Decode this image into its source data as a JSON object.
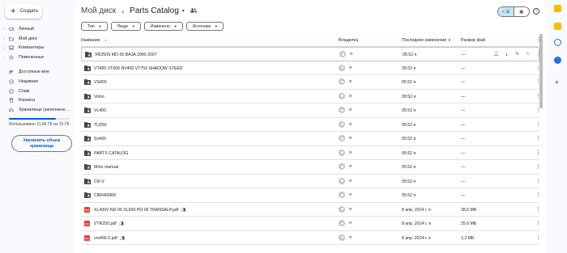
{
  "new_label": "Создать",
  "sidebar": {
    "items": [
      {
        "label": "Личный",
        "icon": "drive-icon"
      },
      {
        "label": "Мой диск",
        "icon": "folder-icon"
      },
      {
        "label": "Компьютеры",
        "icon": "computer-icon"
      },
      {
        "label": "Помеченные",
        "icon": "star-icon"
      },
      {
        "label": "Доступные мне",
        "icon": "people-icon"
      },
      {
        "label": "Недавние",
        "icon": "clock-icon"
      },
      {
        "label": "Спам",
        "icon": "spam-icon"
      },
      {
        "label": "Корзина",
        "icon": "trash-icon"
      },
      {
        "label": "Хранилище (заполнено ...",
        "icon": "cloud-icon"
      }
    ],
    "storage_text": "Использовано 11,46 ГБ из 15 ГБ",
    "storage_fraction": 0.764,
    "upgrade_label": "Увеличить объем хранилища"
  },
  "breadcrumb": {
    "root": "Мой диск",
    "current": "Parts Catalog"
  },
  "filters": [
    "Тип",
    "Люди",
    "Изменено",
    "Источник"
  ],
  "columns": {
    "name": "Название",
    "owner": "Владелец",
    "modified": "Последнее изменение",
    "size": "Размер фай"
  },
  "files": [
    {
      "name": "XR250S MD-30 BAJA 2000-2007",
      "type": "folder",
      "owner": "я",
      "modified": "05:52 я",
      "size": "—",
      "selected": true
    },
    {
      "name": "VT400 VT600 NV400 VT750 SHADOW STEED",
      "type": "folder",
      "owner": "я",
      "modified": "05:52 я",
      "size": "—"
    },
    {
      "name": "VS400",
      "type": "folder",
      "owner": "я",
      "modified": "05:52 я",
      "size": "—"
    },
    {
      "name": "Volvo",
      "type": "folder",
      "owner": "я",
      "modified": "05:52 я",
      "size": "—"
    },
    {
      "name": "VL400",
      "type": "folder",
      "owner": "я",
      "modified": "05:52 я",
      "size": "—"
    },
    {
      "name": "TU250",
      "type": "folder",
      "owner": "я",
      "modified": "05:52 я",
      "size": "—"
    },
    {
      "name": "Sv400",
      "type": "folder",
      "owner": "я",
      "modified": "05:52 я",
      "size": "—"
    },
    {
      "name": "PARTS CATALOG",
      "type": "folder",
      "owner": "я",
      "modified": "05:52 я",
      "size": "—"
    },
    {
      "name": "Moto manual",
      "type": "folder",
      "owner": "я",
      "modified": "05:52 я",
      "size": "—"
    },
    {
      "name": "CR-V",
      "type": "folder",
      "owner": "я",
      "modified": "05:52 я",
      "size": "—"
    },
    {
      "name": "CBR400RR",
      "type": "folder",
      "owner": "я",
      "modified": "05:52 я",
      "size": "—"
    },
    {
      "name": "XL400V ND-06 XL600 PD-06 TRANSALP.pdf",
      "type": "pdf",
      "shared": true,
      "owner": "я",
      "modified": "8 апр. 2014 г. я",
      "size": "38,6 МБ"
    },
    {
      "name": "VTR250.pdf",
      "type": "pdf",
      "shared": true,
      "owner": "я",
      "modified": "8 апр. 2014 г. я",
      "size": "25,6 МБ"
    },
    {
      "name": "vrx400-2.pdf",
      "type": "pdf",
      "shared": true,
      "owner": "я",
      "modified": "8 апр. 2014 г. я",
      "size": "1,2 МБ"
    }
  ],
  "colors": {
    "accent": "#0b57d0",
    "selected_bg": "#c2e7ff",
    "pdf": "#ea4335",
    "folder": "#444746"
  }
}
